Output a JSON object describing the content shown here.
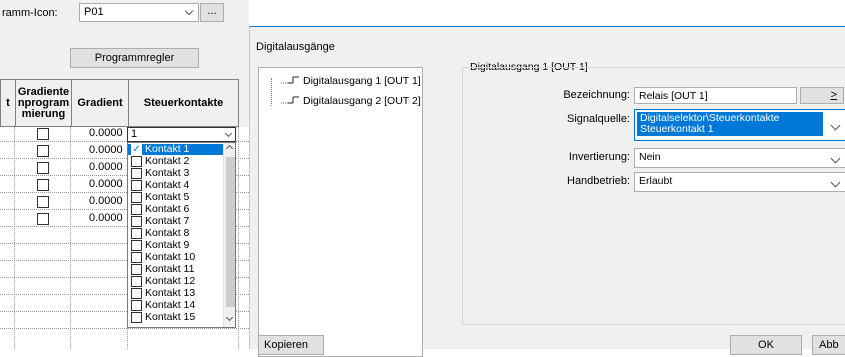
{
  "left": {
    "program_icon_label": "ramm-Icon:",
    "program_icon_value": "P01",
    "ellipsis_label": "...",
    "program_controller_button": "Programmregler",
    "table": {
      "col_t_header": "t",
      "col_gradient_program_header": "Gradiente nprogram mierung",
      "col_gradient_header": "Gradient",
      "col_contacts_header": "Steuerkontakte",
      "gradient_values": [
        "0.0000",
        "0.0000",
        "0.0000",
        "0.0000",
        "0.0000",
        "0.0000"
      ],
      "contacts_value": "1"
    },
    "contact_list": {
      "items": [
        "Kontakt 1",
        "Kontakt 2",
        "Kontakt 3",
        "Kontakt 4",
        "Kontakt 5",
        "Kontakt 6",
        "Kontakt 7",
        "Kontakt 8",
        "Kontakt 9",
        "Kontakt 10",
        "Kontakt 11",
        "Kontakt 12",
        "Kontakt 13",
        "Kontakt 14",
        "Kontakt 15"
      ],
      "selected_index": 0
    }
  },
  "dialog": {
    "title": "Digitalausgänge",
    "tree": [
      "Digitalausgang 1 [OUT 1]",
      "Digitalausgang 2 [OUT 2]"
    ],
    "group_title": "Digitalausgang 1 [OUT 1]",
    "fields": {
      "name_label": "Bezeichnung:",
      "name_value": "Relais [OUT 1]",
      "name_button": ">",
      "signal_label": "Signalquelle:",
      "signal_line1": "Digitalselektor\\Steuerkontakte",
      "signal_line2": "Steuerkontakt 1",
      "invert_label": "Invertierung:",
      "invert_value": "Nein",
      "manual_label": "Handbetrieb:",
      "manual_value": "Erlaubt"
    },
    "buttons": {
      "copy": "Kopieren",
      "ok": "OK",
      "cancel": "Abb"
    }
  },
  "colors": {
    "accent": "#0078d7",
    "pane_bg": "#f0f0f0"
  }
}
